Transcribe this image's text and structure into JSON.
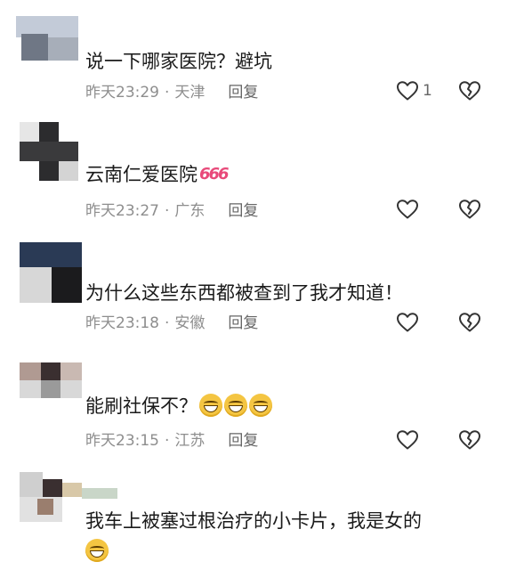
{
  "comments": [
    {
      "text": "说一下哪家医院？避坑",
      "time": "昨天23:29",
      "location": "天津",
      "reply": "回复",
      "likes": "1",
      "suffix": ""
    },
    {
      "text": "云南仁爱医院",
      "time": "昨天23:27",
      "location": "广东",
      "reply": "回复",
      "likes": "",
      "suffix": "666"
    },
    {
      "text": "为什么这些东西都被查到了我才知道！",
      "time": "昨天23:18",
      "location": "安徽",
      "reply": "回复",
      "likes": "",
      "suffix": ""
    },
    {
      "text": "能刷社保不？",
      "time": "昨天23:15",
      "location": "江苏",
      "reply": "回复",
      "likes": "",
      "suffix": ""
    },
    {
      "text": "我车上被塞过根治疗的小卡片，我是女的",
      "time": "",
      "location": "",
      "reply": "",
      "likes": "",
      "suffix": ""
    }
  ],
  "icons": {
    "like": "heart-outline-icon",
    "dislike": "broken-heart-icon",
    "emoji": "grinning-squint-emoji"
  },
  "colors": {
    "text": "#1a1a1a",
    "meta": "#8e8e8e",
    "icon": "#333333",
    "sticker": "#e84a7a"
  }
}
